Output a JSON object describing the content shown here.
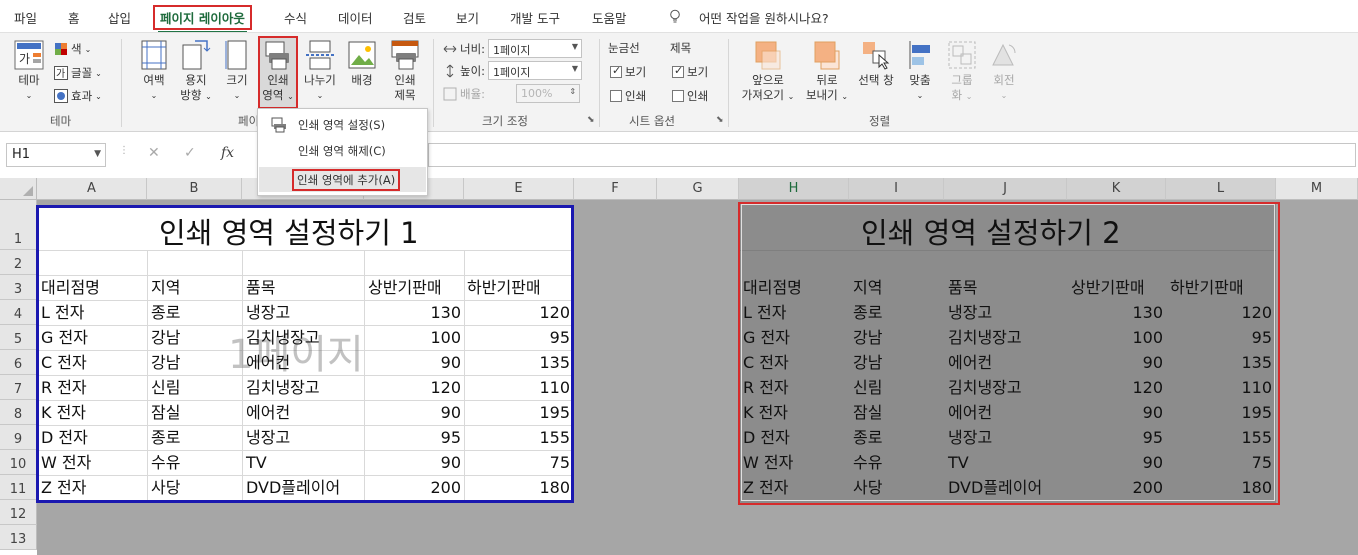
{
  "menu": {
    "items": [
      "파일",
      "홈",
      "삽입",
      "페이지 레이아웃",
      "수식",
      "데이터",
      "검토",
      "보기",
      "개발 도구",
      "도움말"
    ],
    "active_index": 3,
    "tell_me": "어떤 작업을 원하시나요?"
  },
  "ribbon": {
    "theme_group": {
      "theme_btn": "테마",
      "colors": "색",
      "fonts": "글꼴",
      "effects": "효과",
      "label": "테마"
    },
    "page_setup": {
      "margins": "여백",
      "orientation": [
        "용지",
        "방향"
      ],
      "size": "크기",
      "print_area": [
        "인쇄",
        "영역"
      ],
      "breaks": "나누기",
      "background": "배경",
      "print_titles": [
        "인쇄",
        "제목"
      ],
      "label": "페이"
    },
    "scale": {
      "width_label": "너비:",
      "width_value": "1페이지",
      "height_label": "높이:",
      "height_value": "1페이지",
      "scale_label": "배율:",
      "scale_value": "100%",
      "label": "크기 조정"
    },
    "sheet_options": {
      "gridlines": "눈금선",
      "headings": "제목",
      "view": "보기",
      "print": "인쇄",
      "label": "시트 옵션"
    },
    "arrange": {
      "bring_forward": [
        "앞으로",
        "가져오기"
      ],
      "send_backward": [
        "뒤로",
        "보내기"
      ],
      "selection_pane": "선택 창",
      "align": "맞춤",
      "group": [
        "그룹",
        "화"
      ],
      "rotate": "회전",
      "label": "정렬"
    }
  },
  "dropdown": {
    "items": [
      "인쇄 영역 설정(S)",
      "인쇄 영역 해제(C)",
      "인쇄 영역에 추가(A)"
    ],
    "highlighted_index": 2
  },
  "formula_bar": {
    "name_box": "H1",
    "cancel": "✕",
    "enter": "✓",
    "fx": "fx",
    "value": ""
  },
  "sheet": {
    "columns": [
      "A",
      "B",
      "C",
      "D",
      "E",
      "F",
      "G",
      "H",
      "I",
      "J",
      "K",
      "L",
      "M"
    ],
    "rows": [
      "1",
      "2",
      "3",
      "4",
      "5",
      "6",
      "7",
      "8",
      "9",
      "10",
      "11",
      "12",
      "13"
    ],
    "page_watermark": "1페이지",
    "table1": {
      "title": "인쇄 영역 설정하기 1",
      "headers": [
        "대리점명",
        "지역",
        "품목",
        "상반기판매",
        "하반기판매"
      ],
      "rows": [
        [
          "L 전자",
          "종로",
          "냉장고",
          "130",
          "120"
        ],
        [
          "G 전자",
          "강남",
          "김치냉장고",
          "100",
          "95"
        ],
        [
          "C 전자",
          "강남",
          "에어컨",
          "90",
          "135"
        ],
        [
          "R 전자",
          "신림",
          "김치냉장고",
          "120",
          "110"
        ],
        [
          "K 전자",
          "잠실",
          "에어컨",
          "90",
          "195"
        ],
        [
          "D 전자",
          "종로",
          "냉장고",
          "95",
          "155"
        ],
        [
          "W 전자",
          "수유",
          "TV",
          "90",
          "75"
        ],
        [
          "Z 전자",
          "사당",
          "DVD플레이어",
          "200",
          "180"
        ]
      ]
    },
    "table2": {
      "title": "인쇄 영역 설정하기 2",
      "headers": [
        "대리점명",
        "지역",
        "품목",
        "상반기판매",
        "하반기판매"
      ],
      "rows": [
        [
          "L 전자",
          "종로",
          "냉장고",
          "130",
          "120"
        ],
        [
          "G 전자",
          "강남",
          "김치냉장고",
          "100",
          "95"
        ],
        [
          "C 전자",
          "강남",
          "에어컨",
          "90",
          "135"
        ],
        [
          "R 전자",
          "신림",
          "김치냉장고",
          "120",
          "110"
        ],
        [
          "K 전자",
          "잠실",
          "에어컨",
          "90",
          "195"
        ],
        [
          "D 전자",
          "종로",
          "냉장고",
          "95",
          "155"
        ],
        [
          "W 전자",
          "수유",
          "TV",
          "90",
          "75"
        ],
        [
          "Z 전자",
          "사당",
          "DVD플레이어",
          "200",
          "180"
        ]
      ]
    }
  },
  "colors": {
    "excel_green": "#217346",
    "highlight_red": "#d62b2b",
    "print_area_blue": "#1a18b0"
  }
}
